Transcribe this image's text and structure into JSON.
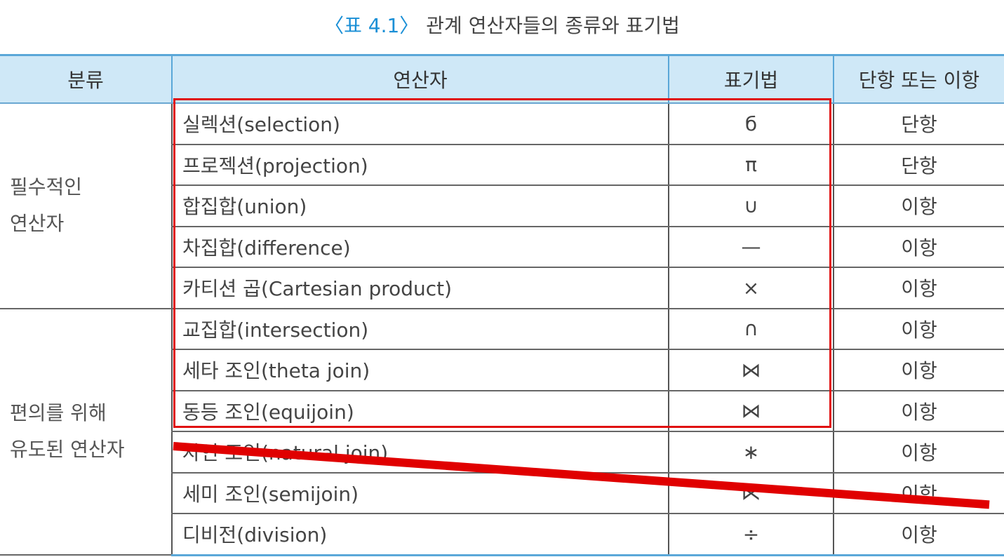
{
  "title": {
    "prefix": "〈표",
    "number": "4.1〉",
    "text": "관계 연산자들의 종류와 표기법"
  },
  "headers": [
    "분류",
    "연산자",
    "표기법",
    "단항 또는 이항"
  ],
  "categories": [
    {
      "line1": "필수적인",
      "line2": "연산자"
    },
    {
      "line1": "편의를 위해",
      "line2": "유도된 연산자"
    }
  ],
  "rows": [
    {
      "op": "실렉션(selection)",
      "sym": "б",
      "arity": "단항"
    },
    {
      "op": "프로젝션(projection)",
      "sym": "π",
      "arity": "단항"
    },
    {
      "op": "합집합(union)",
      "sym": "∪",
      "arity": "이항"
    },
    {
      "op": "차집합(difference)",
      "sym": "—",
      "arity": "이항"
    },
    {
      "op": "카티션 곱(Cartesian product)",
      "sym": "×",
      "arity": "이항"
    },
    {
      "op": "교집합(intersection)",
      "sym": "∩",
      "arity": "이항"
    },
    {
      "op": "세타 조인(theta join)",
      "sym": "⋈",
      "arity": "이항"
    },
    {
      "op": "동등 조인(equijoin)",
      "sym": "⋈",
      "arity": "이항"
    },
    {
      "op": "자연 조인(natural join)",
      "sym": "∗",
      "arity": "이항"
    },
    {
      "op": "세미 조인(semijoin)",
      "sym": "⋉",
      "arity": "이항"
    },
    {
      "op": "디비전(division)",
      "sym": "÷",
      "arity": "이항"
    }
  ],
  "annotations": {
    "highlight_color": "#e01010",
    "strike_color": "#e00000"
  }
}
